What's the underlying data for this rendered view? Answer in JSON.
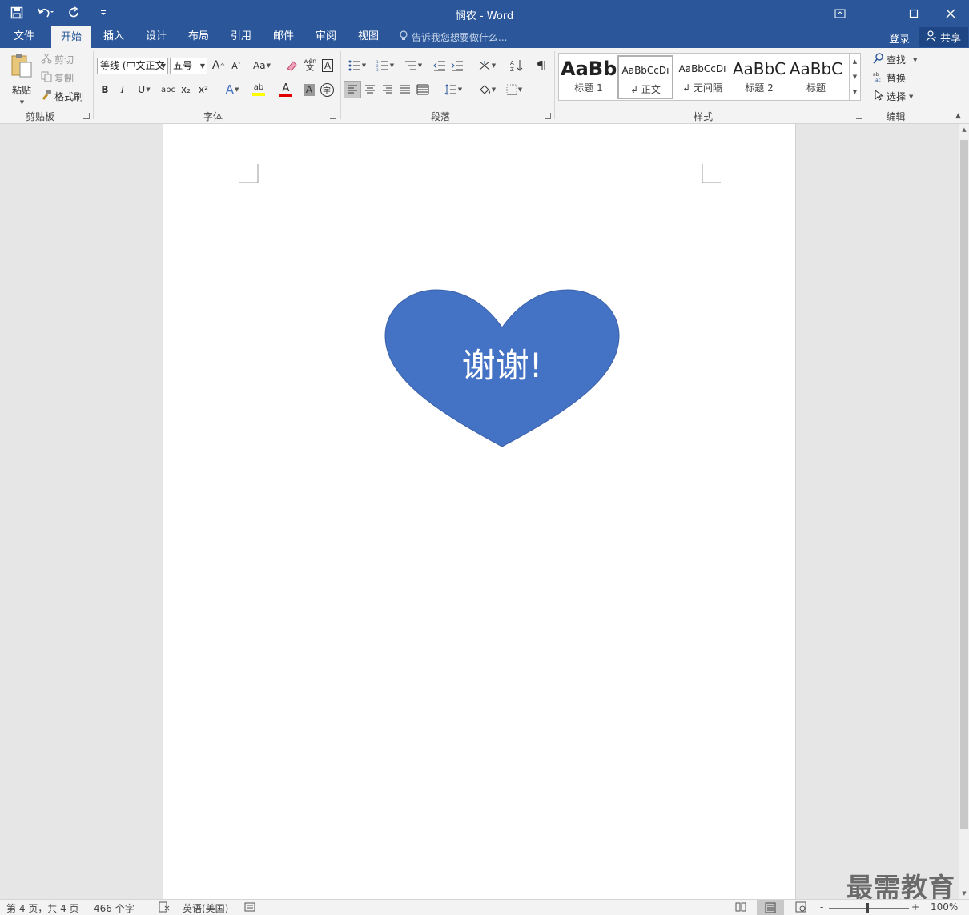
{
  "window": {
    "title": "悯农 - Word",
    "min_icon": "minimize-icon",
    "max_icon": "maximize-icon",
    "close_icon": "close-icon"
  },
  "qat": {
    "save_icon": "save-icon",
    "undo_icon": "undo-icon",
    "redo_icon": "redo-icon",
    "customize_icon": "customize-qat-icon"
  },
  "tabs": [
    "文件",
    "开始",
    "插入",
    "设计",
    "布局",
    "引用",
    "邮件",
    "审阅",
    "视图"
  ],
  "active_tab": "开始",
  "tell_me": "告诉我您想要做什么...",
  "account": {
    "login": "登录",
    "share": "共享"
  },
  "clipboard": {
    "paste": "粘贴",
    "cut": "剪切",
    "copy": "复制",
    "format_painter": "格式刷",
    "label": "剪贴板"
  },
  "font": {
    "name": "等线 (中文正文",
    "size": "五号",
    "label": "字体",
    "change_case": "Aa",
    "bold": "B",
    "italic": "I",
    "underline": "U",
    "strike": "abc",
    "subscript": "x₂",
    "superscript": "x²",
    "phonetic": "wén",
    "phonetic_sub": "文",
    "char_border": "A",
    "char_shading": "A",
    "enclose": "字",
    "text_effect": "A",
    "highlight": "ab",
    "font_color": "A",
    "grow": "A",
    "shrink": "A",
    "grow_sup": "^",
    "shrink_sup": "ˇ",
    "highlight_color": "#ffff00",
    "font_color_value": "#e00000"
  },
  "paragraph": {
    "label": "段落"
  },
  "styles": {
    "label": "样式",
    "items": [
      {
        "sample": "AaBb",
        "name": "标题 1"
      },
      {
        "sample": "AaBbCcDı",
        "name": "↲ 正文"
      },
      {
        "sample": "AaBbCcDı",
        "name": "↲ 无间隔"
      },
      {
        "sample": "AaBbC",
        "name": "标题 2"
      },
      {
        "sample": "AaBbC",
        "name": "标题"
      }
    ]
  },
  "editing": {
    "label": "编辑",
    "find": "查找",
    "replace": "替换",
    "select": "选择"
  },
  "document": {
    "shape_text": "谢谢!",
    "shape_color": "#4472c4",
    "shape_border": "#3a60a8"
  },
  "watermark": "最需教育",
  "status": {
    "page": "第 4 页，共 4 页",
    "words": "466 个字",
    "language": "英语(美国)",
    "zoom": "100%",
    "zoom_minus": "-",
    "zoom_plus": "+"
  }
}
